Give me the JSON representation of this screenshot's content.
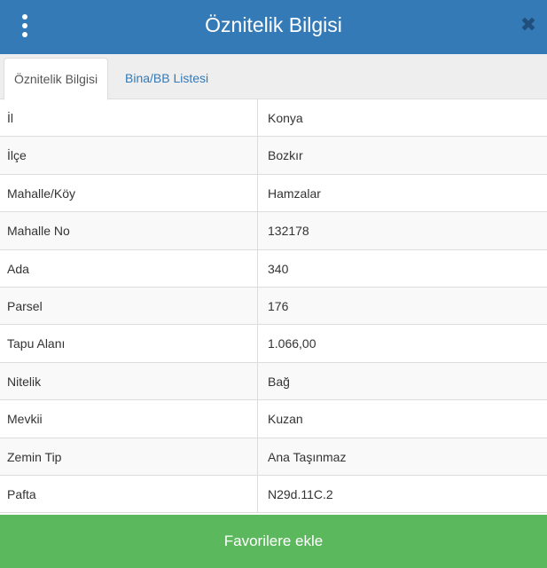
{
  "header": {
    "title": "Öznitelik Bilgisi",
    "menu_icon": "vertical-dots-icon",
    "close_icon": "close-icon"
  },
  "tabs": [
    {
      "label": "Öznitelik Bilgisi",
      "active": true
    },
    {
      "label": "Bina/BB Listesi",
      "active": false
    }
  ],
  "attributes": [
    {
      "label": "İl",
      "value": "Konya"
    },
    {
      "label": "İlçe",
      "value": "Bozkır"
    },
    {
      "label": "Mahalle/Köy",
      "value": "Hamzalar"
    },
    {
      "label": "Mahalle No",
      "value": "132178"
    },
    {
      "label": "Ada",
      "value": "340"
    },
    {
      "label": "Parsel",
      "value": "176"
    },
    {
      "label": "Tapu Alanı",
      "value": "1.066,00"
    },
    {
      "label": "Nitelik",
      "value": "Bağ"
    },
    {
      "label": "Mevkii",
      "value": "Kuzan"
    },
    {
      "label": "Zemin Tip",
      "value": "Ana Taşınmaz"
    },
    {
      "label": "Pafta",
      "value": "N29d.11C.2"
    }
  ],
  "footer": {
    "favorite_label": "Favorilere ekle"
  },
  "colors": {
    "header_bg": "#337ab7",
    "button_bg": "#5cb85c",
    "tab_link": "#337ab7"
  }
}
